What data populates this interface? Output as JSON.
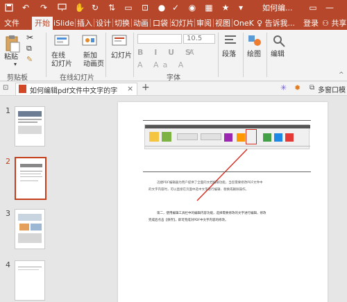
{
  "app": {
    "window_title": "如何编...",
    "user_button": "共享",
    "login": "登录"
  },
  "tabs": [
    "文件",
    "开始",
    "iSlide",
    "插入",
    "设计",
    "切换",
    "动画",
    "口袋",
    "幻灯片",
    "审阅",
    "视图",
    "OneK"
  ],
  "tell_me": "告诉我...",
  "ribbon": {
    "paste": "粘贴",
    "clipboard_group": "剪贴板",
    "online_slides": "在线\n幻灯片",
    "new_anim_page": "新加\n动画页",
    "online_slides_group": "在线幻灯片",
    "slides": "幻灯片",
    "font_size": "10.5",
    "font_group": "字体",
    "paragraph": "段落",
    "drawing": "绘图",
    "editing": "编辑"
  },
  "doc_tab": {
    "title": "如何编辑pdf文件中文字的字",
    "multi_window": "多窗口模"
  },
  "slides": [
    {
      "number": "1",
      "selected": false
    },
    {
      "number": "2",
      "selected": true
    },
    {
      "number": "3",
      "selected": false
    },
    {
      "number": "4",
      "selected": false
    }
  ],
  "page_content": {
    "para1_line1": "迅捷PDF编辑器为用户提供了全面的文档编辑功能，当您需要修改PDF文件中",
    "para1_line2": "的文字内容时，可以直接在页面中选中文字进行编辑、替换或删除操作。",
    "para2_line1": "第二，使用编辑工具栏中的编辑内容功能，选择需要修改的文字进行编辑，修改",
    "para2_line2": "完成后点击【保存】，即可完成对PDF中文字内容的修改。"
  },
  "colors": {
    "accent": "#b7472a",
    "selected_border": "#c43e1c",
    "ribbon_bg": "#f3f3f3"
  }
}
